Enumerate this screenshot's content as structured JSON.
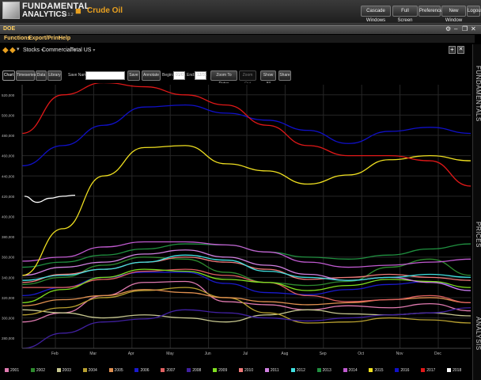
{
  "app": {
    "logo_line1": "FUNDAMENTAL",
    "logo_line2": "ANALYTICS",
    "logo_version": "v4.1.2",
    "page_title": "Crude Oil",
    "window_buttons": [
      "Cascade Windows",
      "Full Screen",
      "Preferences",
      "New Window",
      "Logout"
    ]
  },
  "panel": {
    "title": "DOE",
    "menu": [
      "Functions",
      "Export/Print",
      "Help"
    ]
  },
  "selectors": {
    "items": [
      "Stocks",
      "Commercial",
      "Total US"
    ]
  },
  "side_tabs": [
    "FUNDAMENTALS",
    "PRICES",
    "ANALYSIS"
  ],
  "toolbar": {
    "tabs": [
      "Chart",
      "Timeseries",
      "Data",
      "Library"
    ],
    "save_name_label": "Save Name:",
    "save_name_value": "",
    "save_button": "Save",
    "annotate_button": "Annotate",
    "begin_label": "Begin:",
    "begin_value": "01/01",
    "end_label": "End:",
    "end_value": "12/31",
    "zoom_to_dates": "Zoom To Dates",
    "zoom_out": "Zoom Out",
    "show_all": "Show All",
    "share": "Share"
  },
  "chart_data": {
    "type": "line",
    "x": [
      "Feb",
      "Mar",
      "Apr",
      "May",
      "Jun",
      "Jul",
      "Aug",
      "Sep",
      "Oct",
      "Nov",
      "Dec"
    ],
    "xlabel": "",
    "ylabel": "",
    "y_ticks": [
      "280,000",
      "300,000",
      "320,000",
      "340,000",
      "360,000",
      "380,000",
      "400,000",
      "420,000",
      "440,000",
      "460,000",
      "480,000",
      "500,000",
      "520,000"
    ],
    "ylim": [
      270000,
      530000
    ],
    "grid": true,
    "legend_position": "bottom",
    "series": [
      {
        "name": "2001",
        "color": "#e07ab0",
        "values": [
          296000,
          305000,
          322000,
          335000,
          336000,
          316000,
          313000,
          308000,
          312000,
          310000,
          314000,
          307000
        ]
      },
      {
        "name": "2002",
        "color": "#2e8b2e",
        "values": [
          333000,
          340000,
          352000,
          360000,
          358000,
          345000,
          335000,
          332000,
          336000,
          350000,
          358000,
          342000
        ]
      },
      {
        "name": "2003",
        "color": "#c8c890",
        "values": [
          308000,
          305000,
          300000,
          303000,
          300000,
          296000,
          303000,
          308000,
          304000,
          303000,
          305000,
          302000
        ]
      },
      {
        "name": "2004",
        "color": "#b8a030",
        "values": [
          303000,
          310000,
          320000,
          327000,
          330000,
          320000,
          305000,
          295000,
          296000,
          300000,
          298000,
          295000
        ]
      },
      {
        "name": "2005",
        "color": "#e09050",
        "values": [
          312000,
          318000,
          322000,
          328000,
          325000,
          320000,
          316000,
          313000,
          315000,
          318000,
          320000,
          315000
        ]
      },
      {
        "name": "2006",
        "color": "#1a1acc",
        "values": [
          322000,
          330000,
          340000,
          345000,
          345000,
          334000,
          325000,
          323000,
          328000,
          333000,
          336000,
          327000
        ]
      },
      {
        "name": "2007",
        "color": "#e06060",
        "values": [
          330000,
          330000,
          338000,
          346000,
          348000,
          342000,
          335000,
          322000,
          316000,
          318000,
          322000,
          315000
        ]
      },
      {
        "name": "2008",
        "color": "#4020a0",
        "values": [
          270000,
          285000,
          296000,
          299000,
          308000,
          305000,
          300000,
          297000,
          300000,
          303000,
          305000,
          310000
        ]
      },
      {
        "name": "2009",
        "color": "#80e020",
        "values": [
          315000,
          328000,
          340000,
          348000,
          346000,
          338000,
          335000,
          327000,
          332000,
          338000,
          336000,
          330000
        ]
      },
      {
        "name": "2010",
        "color": "#f07a7a",
        "values": [
          335000,
          343000,
          348000,
          355000,
          360000,
          355000,
          348000,
          338000,
          340000,
          343000,
          340000,
          337000
        ]
      },
      {
        "name": "2011",
        "color": "#d07fe0",
        "values": [
          342000,
          350000,
          355000,
          363000,
          367000,
          360000,
          352000,
          343000,
          337000,
          340000,
          335000,
          327000
        ]
      },
      {
        "name": "2012",
        "color": "#40e0e0",
        "values": [
          337000,
          342000,
          348000,
          355000,
          362000,
          357000,
          346000,
          340000,
          337000,
          340000,
          343000,
          340000
        ]
      },
      {
        "name": "2013",
        "color": "#209040",
        "values": [
          350000,
          355000,
          362000,
          368000,
          373000,
          372000,
          365000,
          360000,
          358000,
          362000,
          368000,
          373000
        ]
      },
      {
        "name": "2014",
        "color": "#c05ad0",
        "values": [
          356000,
          360000,
          370000,
          375000,
          375000,
          372000,
          365000,
          355000,
          350000,
          352000,
          355000,
          358000
        ]
      },
      {
        "name": "2015",
        "color": "#f0e020",
        "values": [
          342000,
          388000,
          440000,
          468000,
          470000,
          452000,
          445000,
          432000,
          441000,
          456000,
          460000,
          455000
        ]
      },
      {
        "name": "2016",
        "color": "#1010c8",
        "values": [
          450000,
          470000,
          490000,
          508000,
          510000,
          502000,
          495000,
          485000,
          472000,
          484000,
          488000,
          482000
        ]
      },
      {
        "name": "2017",
        "color": "#e01818",
        "values": [
          482000,
          520000,
          532000,
          528000,
          520000,
          510000,
          490000,
          470000,
          460000,
          460000,
          455000,
          430000
        ]
      },
      {
        "name": "2018",
        "color": "#ffffff",
        "values": [
          420000,
          414000,
          418000,
          420000,
          421000
        ]
      }
    ]
  }
}
